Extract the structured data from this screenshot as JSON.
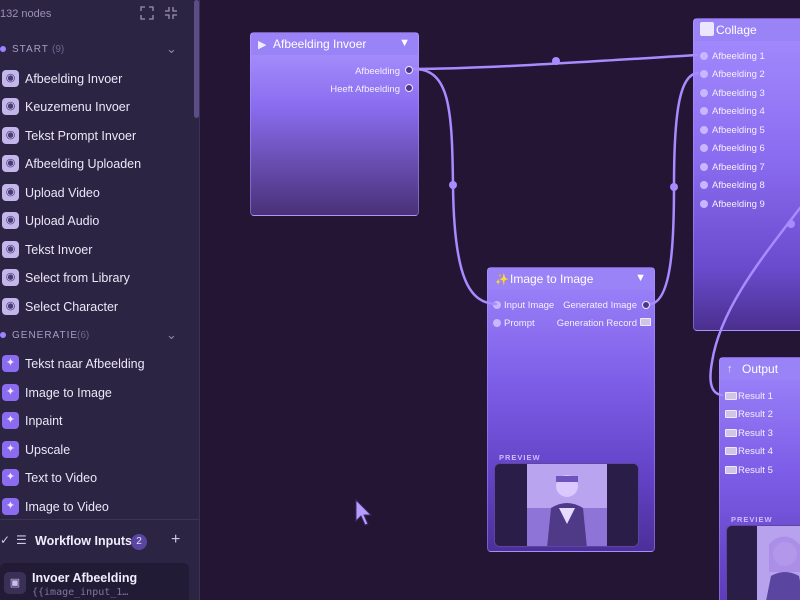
{
  "sidebar": {
    "node_count": "132 nodes",
    "toolbar_icons": [
      "expand-icon",
      "collapse-icon"
    ],
    "sections": [
      {
        "title": "START",
        "count": "(9)",
        "items": [
          {
            "label": "Afbeelding Invoer",
            "icon": "start-node-icon"
          },
          {
            "label": "Keuzemenu Invoer",
            "icon": "start-node-icon"
          },
          {
            "label": "Tekst Prompt Invoer",
            "icon": "start-node-icon"
          },
          {
            "label": "Afbeelding Uploaden",
            "icon": "start-node-icon"
          },
          {
            "label": "Upload Video",
            "icon": "start-node-icon"
          },
          {
            "label": "Upload Audio",
            "icon": "start-node-icon"
          },
          {
            "label": "Tekst Invoer",
            "icon": "start-node-icon"
          },
          {
            "label": "Select from Library",
            "icon": "start-node-icon"
          },
          {
            "label": "Select Character",
            "icon": "start-node-icon"
          }
        ]
      },
      {
        "title": "GENERATIE",
        "count": "(6)",
        "items": [
          {
            "label": "Tekst naar Afbeelding",
            "icon": "generation-node-icon"
          },
          {
            "label": "Image to Image",
            "icon": "generation-node-icon"
          },
          {
            "label": "Inpaint",
            "icon": "generation-node-icon"
          },
          {
            "label": "Upscale",
            "icon": "generation-node-icon"
          },
          {
            "label": "Text to Video",
            "icon": "generation-node-icon"
          },
          {
            "label": "Image to Video",
            "icon": "generation-node-icon"
          }
        ]
      }
    ],
    "workflow_inputs": {
      "label": "Workflow Inputs",
      "badge": "2",
      "items": [
        {
          "title": "Invoer Afbeelding",
          "variable": "{{image_input_1…"
        }
      ]
    }
  },
  "canvas": {
    "nodes": {
      "afbeelding_invoer": {
        "title": "Afbeelding Invoer",
        "outputs": [
          "Afbeelding",
          "Heeft Afbeelding"
        ]
      },
      "collage": {
        "title": "Collage",
        "inputs": [
          "Afbeelding 1",
          "Afbeelding 2",
          "Afbeelding 3",
          "Afbeelding 4",
          "Afbeelding 5",
          "Afbeelding 6",
          "Afbeelding 7",
          "Afbeelding 8",
          "Afbeelding 9"
        ]
      },
      "image_to_image": {
        "title": "Image to Image",
        "inputs": [
          "Input Image",
          "Prompt"
        ],
        "outputs": [
          "Generated Image",
          "Generation Record"
        ],
        "preview_label": "PREVIEW"
      },
      "output": {
        "title": "Output",
        "inputs": [
          "Result 1",
          "Result 2",
          "Result 3",
          "Result 4",
          "Result 5"
        ],
        "preview_label": "PREVIEW"
      }
    }
  },
  "colors": {
    "accent": "#9a82f7",
    "wire": "#a88bff",
    "sidebar_bg": "#2c2443",
    "canvas_bg": "#231533"
  }
}
